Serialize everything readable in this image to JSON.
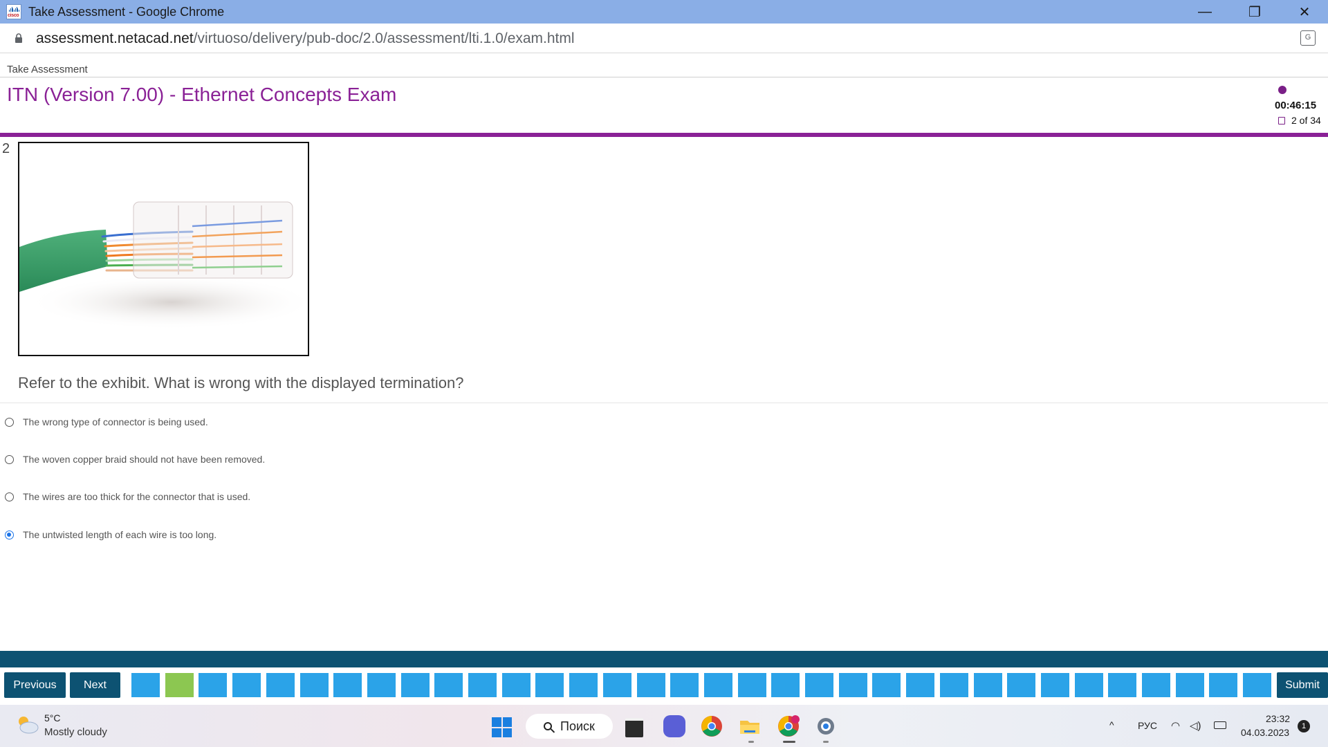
{
  "window": {
    "title": "Take Assessment - Google Chrome",
    "minimize_glyph": "—",
    "maximize_glyph": "❐",
    "close_glyph": "✕"
  },
  "address_bar": {
    "host": "assessment.netacad.net",
    "path": "/virtuoso/delivery/pub-doc/2.0/assessment/lti.1.0/exam.html",
    "translate_glyph": "G"
  },
  "page": {
    "breadcrumb": "Take Assessment",
    "exam_title": "ITN (Version 7.00) - Ethernet Concepts Exam",
    "timer": "00:46:15",
    "question_count": "2 of 34",
    "accent_color": "#8a2196"
  },
  "question": {
    "number": "2",
    "text": "Refer to the exhibit. What is wrong with the displayed termination?",
    "options": [
      {
        "label": "The wrong type of connector is being used.",
        "selected": false
      },
      {
        "label": "The woven copper braid should not have been removed.",
        "selected": false
      },
      {
        "label": "The wires are too thick for the connector that is used.",
        "selected": false
      },
      {
        "label": "The untwisted length of each wire is too long.",
        "selected": true
      }
    ]
  },
  "navigation": {
    "previous_label": "Previous",
    "next_label": "Next",
    "submit_label": "Submit",
    "answered_question_index": 1,
    "colors": {
      "nav": "#0d5272",
      "question": "#2ba3e8",
      "answered": "#8cc751"
    }
  },
  "taskbar": {
    "weather_temp": "5°C",
    "weather_desc": "Mostly cloudy",
    "search_label": "Поиск",
    "icons": [
      "windows-start-icon",
      "task-view-icon",
      "teams-meet-icon",
      "chrome-icon",
      "file-explorer-icon",
      "chrome-profile-icon",
      "settings-icon"
    ],
    "chevron_glyph": "^",
    "language": "РУС",
    "wifi_glyph": "◠",
    "volume_glyph": "◁)",
    "time": "23:32",
    "date": "04.03.2023",
    "notification_count": "1"
  }
}
